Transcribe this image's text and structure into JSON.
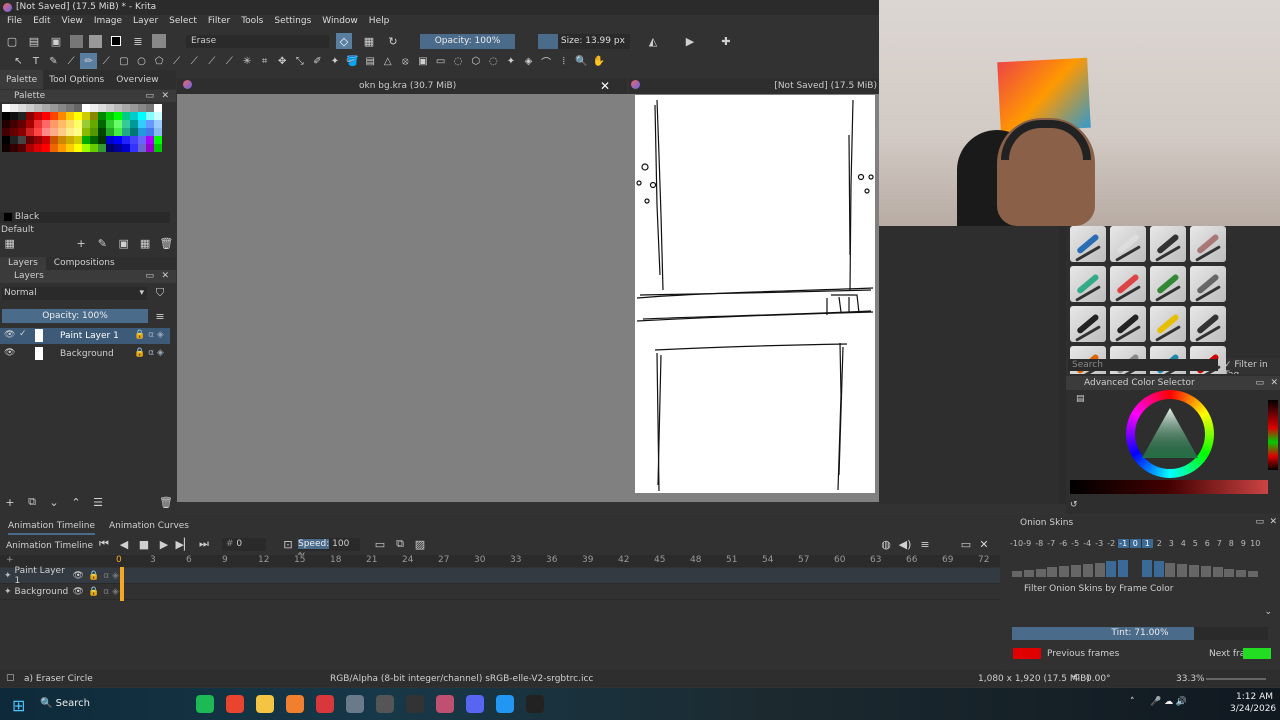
{
  "window": {
    "title": "[Not Saved]  (17.5 MiB) * - Krita"
  },
  "menu": [
    "File",
    "Edit",
    "View",
    "Image",
    "Layer",
    "Select",
    "Filter",
    "Tools",
    "Settings",
    "Window",
    "Help"
  ],
  "toolbar": {
    "brush_preset": "Erase",
    "opacity": "Opacity: 100%",
    "size": "Size: 13.99 px"
  },
  "left_tabs": [
    "Palette",
    "Tool Options",
    "Overview"
  ],
  "palette": {
    "title": "Palette",
    "current_color": "Black",
    "set_name": "Default"
  },
  "layers_tabs": [
    "Layers",
    "Compositions"
  ],
  "layers": {
    "blend_mode": "Normal",
    "opacity": "Opacity:  100%",
    "items": [
      {
        "name": "Paint Layer 1"
      },
      {
        "name": "Background"
      }
    ]
  },
  "docs": {
    "left": "okn bg.kra (30.7 MiB)",
    "right": "[Not Saved]  (17.5 MiB)"
  },
  "colors": {
    "accent": "#4a6b8a",
    "selection": "#3d5a78",
    "red": "#e00000",
    "green": "#22dd22",
    "onion_bar": "#3a6a95"
  },
  "brush_search": {
    "placeholder": "Search",
    "filter_label": "Filter in Tag"
  },
  "color_selector": {
    "title": "Advanced Color Selector"
  },
  "timeline": {
    "tabs": [
      "Animation Timeline",
      "Animation Curves"
    ],
    "title": "Animation Timeline",
    "frame": "0",
    "speed_label": "Speed:",
    "speed": "100 %",
    "ruler": [
      "3",
      "6",
      "9",
      "12",
      "15",
      "18",
      "21",
      "24",
      "27",
      "30",
      "33",
      "36",
      "39",
      "42",
      "45",
      "48",
      "51",
      "54",
      "57",
      "60",
      "63",
      "66",
      "69",
      "72"
    ],
    "layers": [
      "Paint Layer 1",
      "Background"
    ]
  },
  "onion": {
    "title": "Onion Skins",
    "numbers": [
      "-10",
      "-9",
      "-8",
      "-7",
      "-6",
      "-5",
      "-4",
      "-3",
      "-2",
      "-1",
      "0",
      "1",
      "2",
      "3",
      "4",
      "5",
      "6",
      "7",
      "8",
      "9",
      "10"
    ],
    "filter": "Filter Onion Skins by Frame Color",
    "tint": "Tint: 71.00%",
    "tint_value": 0.71,
    "previous": "Previous frames",
    "next": "Next frames"
  },
  "status": {
    "tool": "a) Eraser Circle",
    "colorspace": "RGB/Alpha (8-bit integer/channel)  sRGB-elle-V2-srgbtrc.icc",
    "dimensions": "1,080 x 1,920 (17.5 MiB)",
    "rotation": "0.00°",
    "zoom": "33.3%"
  },
  "taskbar": {
    "search": "Search",
    "time": "1:12 AM",
    "date": "3/24/2026"
  }
}
